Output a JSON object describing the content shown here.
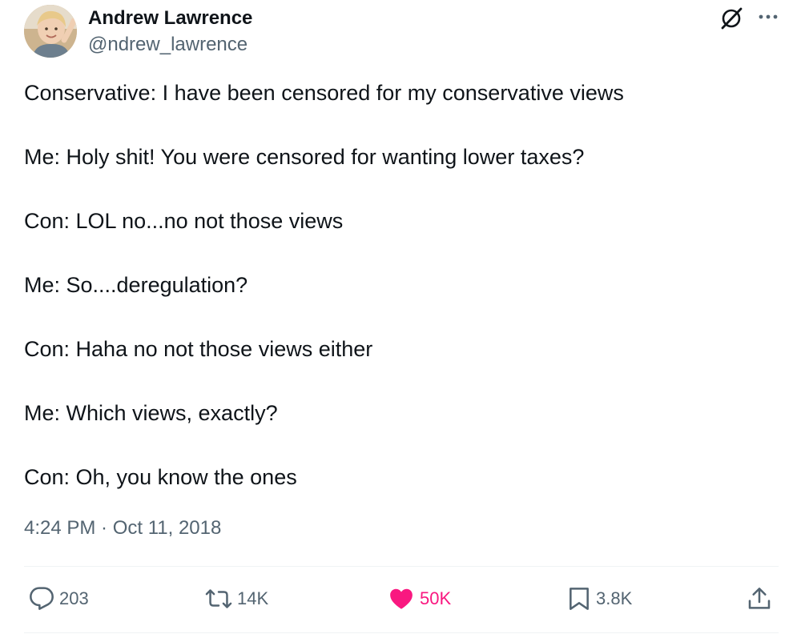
{
  "author": {
    "display_name": "Andrew Lawrence",
    "handle": "@ndrew_lawrence",
    "avatar_icon": "profile-photo"
  },
  "header_icons": {
    "grok": "grok-icon",
    "more": "more-horizontal-icon"
  },
  "tweet": {
    "lines": [
      "Conservative: I have been censored for my conservative views",
      "Me: Holy shit! You were censored for wanting lower taxes?",
      "Con: LOL no...no not those views",
      "Me: So....deregulation?",
      "Con: Haha no not those views either",
      "Me: Which views, exactly?",
      "Con: Oh, you know the ones"
    ],
    "timestamp": "4:24 PM · Oct 11, 2018"
  },
  "actions": {
    "reply_count": "203",
    "retweet_count": "14K",
    "like_count": "50K",
    "bookmark_count": "3.8K"
  },
  "colors": {
    "text": "#0f1419",
    "secondary": "#536471",
    "like": "#f91880",
    "divider": "#eff3f4"
  }
}
